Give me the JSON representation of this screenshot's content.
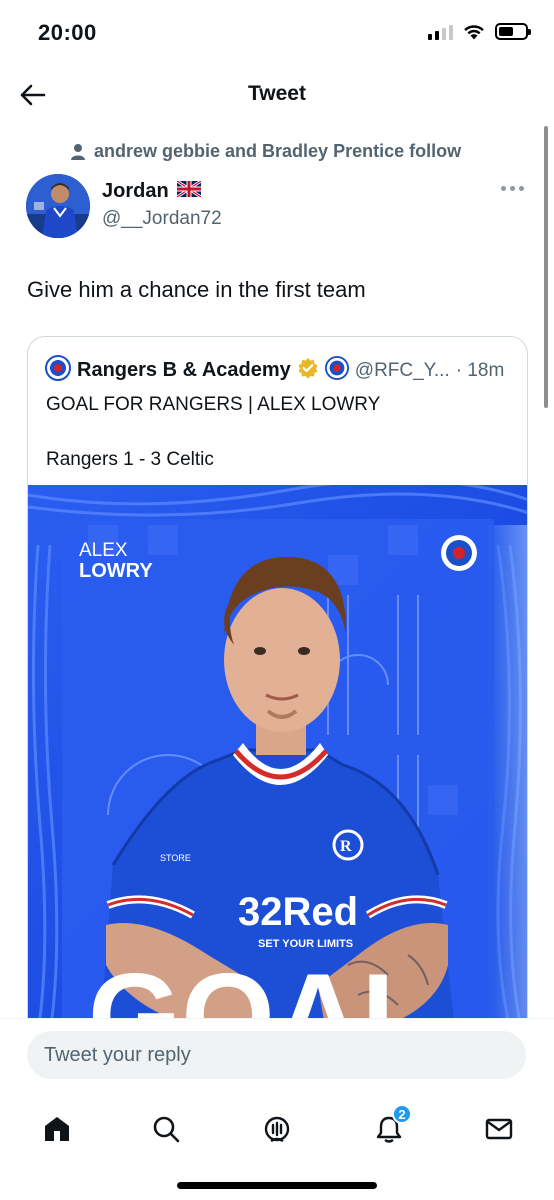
{
  "status": {
    "time": "20:00"
  },
  "header": {
    "title": "Tweet"
  },
  "social_context": "andrew gebbie and Bradley Prentice follow",
  "author": {
    "name": "Jordan",
    "flag": "🇬🇧",
    "handle": "@__Jordan72"
  },
  "tweet": {
    "text": "Give him a chance in the first team"
  },
  "quote": {
    "name": "Rangers B & Academy",
    "handle": "@RFC_Y...",
    "time": "· 18m",
    "line1": "GOAL FOR RANGERS | ALEX LOWRY",
    "line2": "Rangers 1 - 3 Celtic",
    "media": {
      "first_name": "ALEX",
      "last_name": "LOWRY",
      "big_text": "GOAL",
      "sponsor": "32Red",
      "sponsor_tagline": "SET YOUR LIMITS",
      "kit_brand": "STORE"
    }
  },
  "reply": {
    "placeholder": "Tweet your reply"
  },
  "tabs": [
    {
      "id": "home",
      "icon": "home-icon"
    },
    {
      "id": "search",
      "icon": "search-icon"
    },
    {
      "id": "spaces",
      "icon": "spaces-icon"
    },
    {
      "id": "notifications",
      "icon": "bell-icon",
      "badge": "2"
    },
    {
      "id": "messages",
      "icon": "mail-icon"
    }
  ],
  "colors": {
    "accent": "#1d9bf0",
    "rangers_blue": "#1f4fe0",
    "verified_gold": "#e8b829"
  }
}
